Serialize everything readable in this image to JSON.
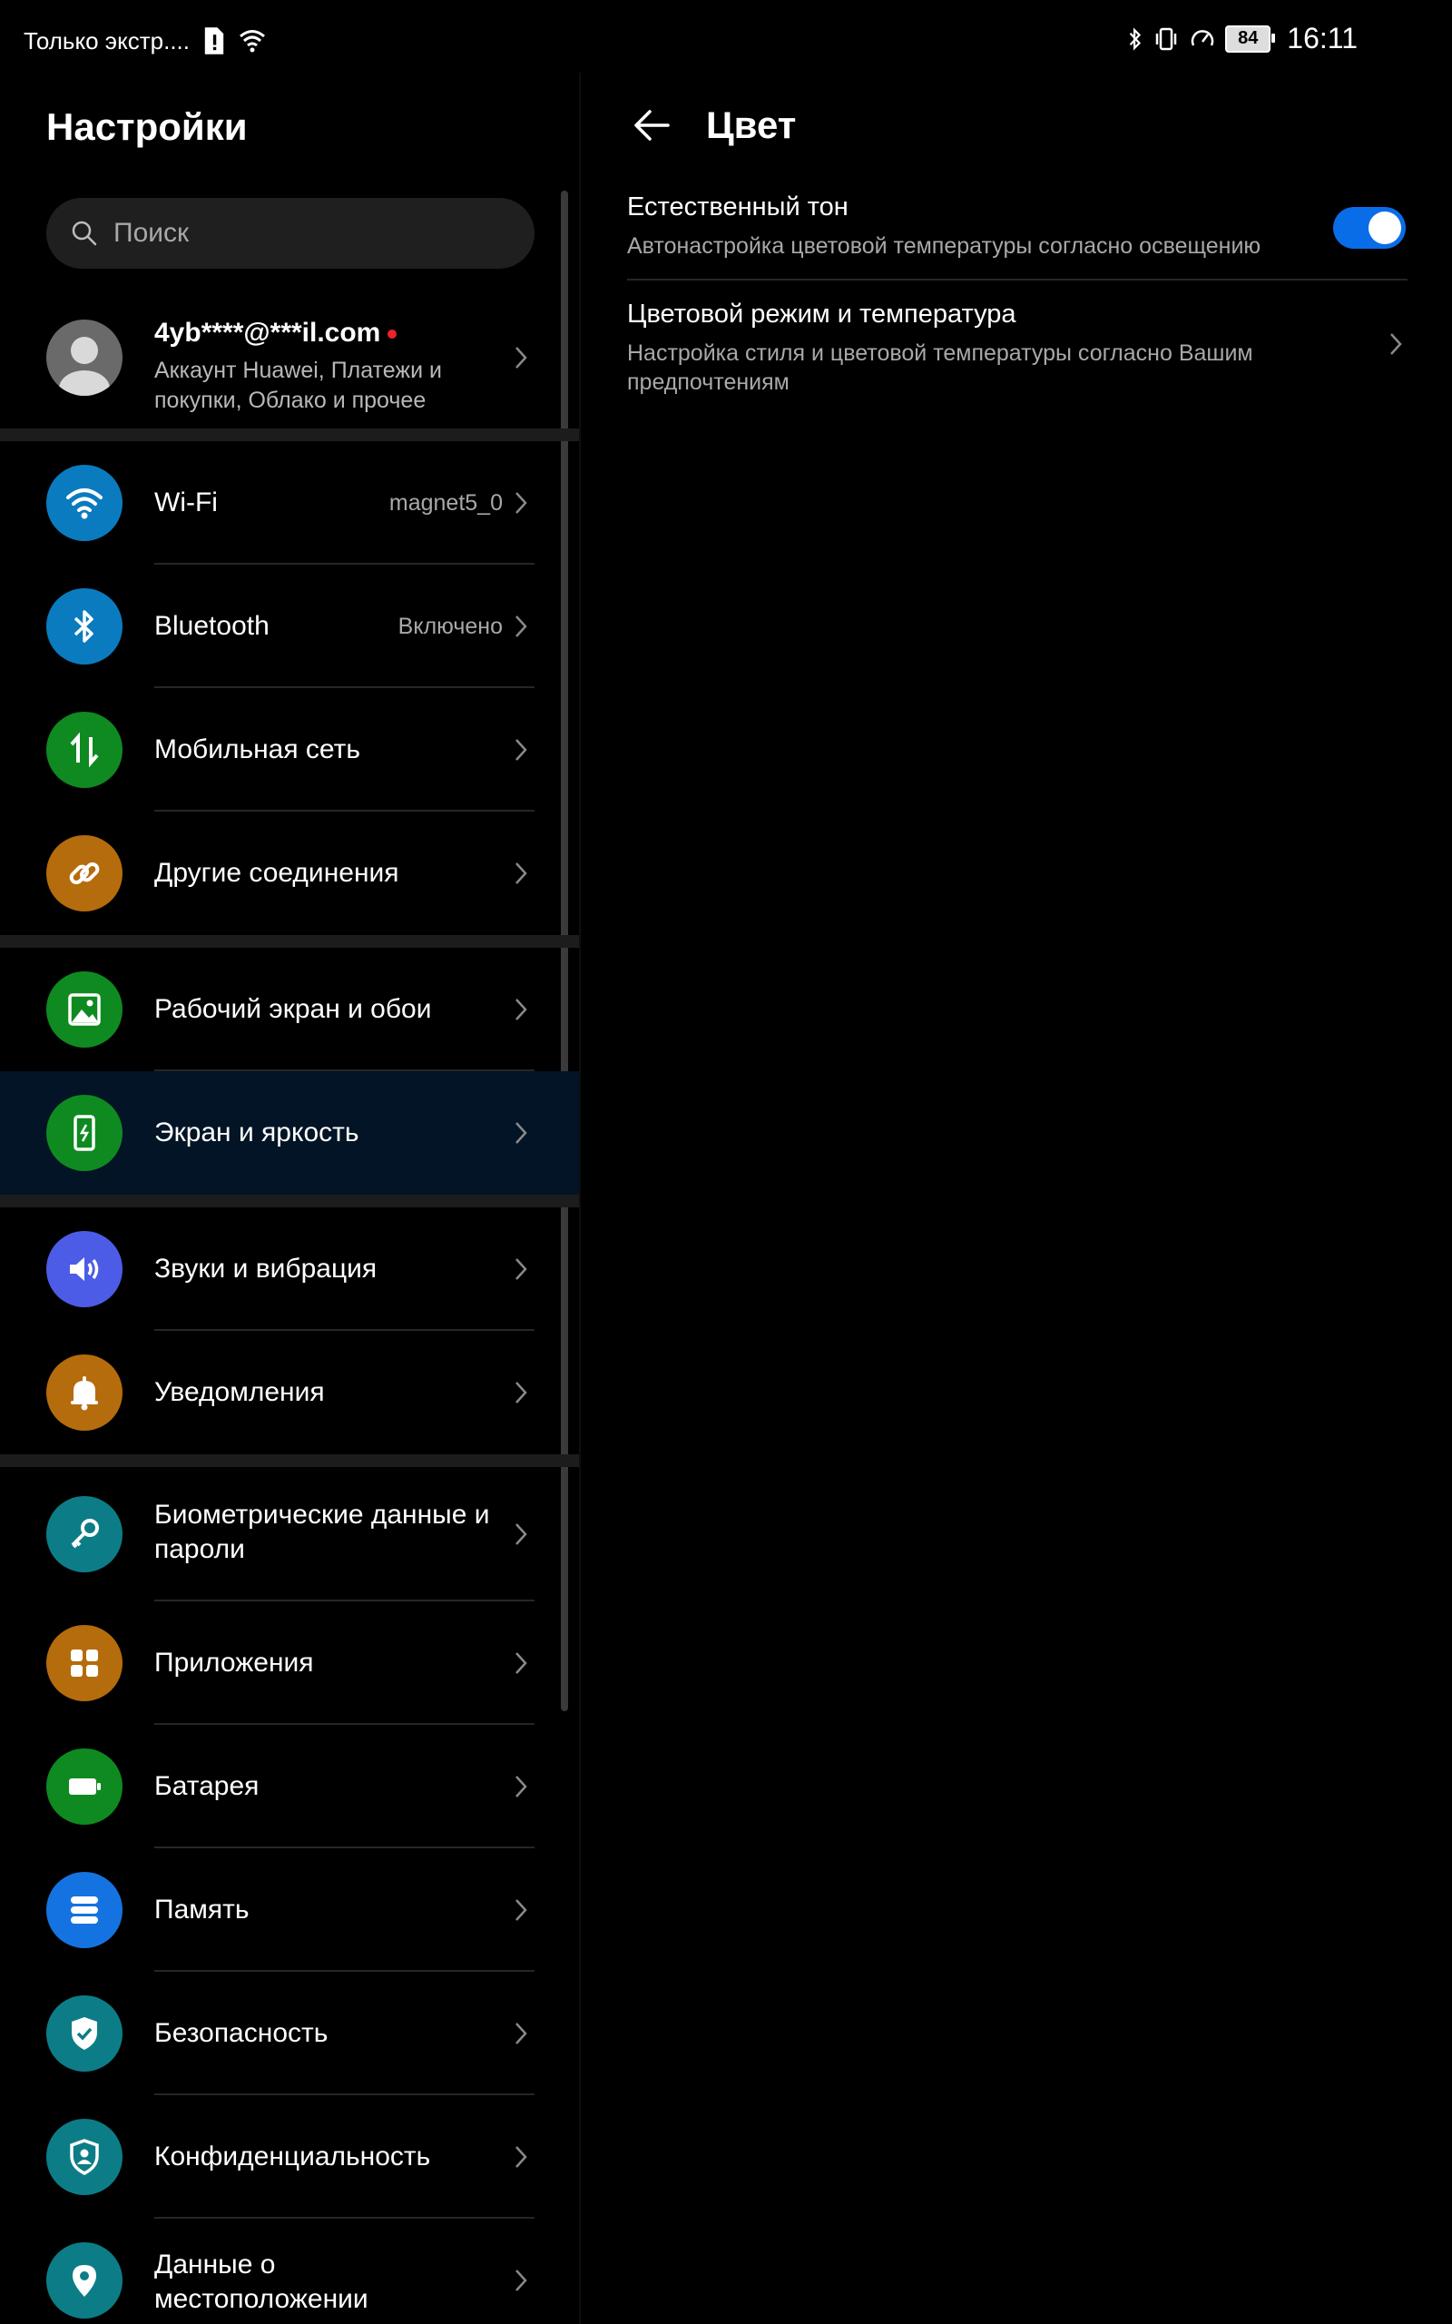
{
  "status_bar": {
    "notification_text": "Только экстр....",
    "battery": "84",
    "time": "16:11"
  },
  "settings": {
    "title": "Настройки",
    "search_placeholder": "Поиск",
    "account": {
      "email": "4yb****@***il.com",
      "description": "Аккаунт Huawei, Платежи и покупки, Облако и прочее"
    },
    "items": [
      {
        "label": "Wi-Fi",
        "value": "magnet5_0",
        "icon": "wifi-icon",
        "color": "#0b7bc0"
      },
      {
        "label": "Bluetooth",
        "value": "Включено",
        "icon": "bluetooth-icon",
        "color": "#0b7bc0"
      },
      {
        "label": "Мобильная сеть",
        "icon": "mobile-data-icon",
        "color": "#0f8a21"
      },
      {
        "label": "Другие соединения",
        "icon": "link-icon",
        "color": "#b56c0c"
      },
      {
        "label": "Рабочий экран и обои",
        "icon": "wallpaper-icon",
        "color": "#0f8a21"
      },
      {
        "label": "Экран и яркость",
        "icon": "display-icon",
        "color": "#0f8a21"
      },
      {
        "label": "Звуки и вибрация",
        "icon": "sound-icon",
        "color": "#4d5ce6"
      },
      {
        "label": "Уведомления",
        "icon": "bell-icon",
        "color": "#b56c0c"
      },
      {
        "label": "Биометрические данные и пароли",
        "icon": "key-icon",
        "color": "#0c7d86"
      },
      {
        "label": "Приложения",
        "icon": "apps-icon",
        "color": "#b56c0c"
      },
      {
        "label": "Батарея",
        "icon": "battery-icon",
        "color": "#0f8a21"
      },
      {
        "label": "Память",
        "icon": "storage-icon",
        "color": "#1473e0"
      },
      {
        "label": "Безопасность",
        "icon": "shield-icon",
        "color": "#0c7d86"
      },
      {
        "label": "Конфиденциальность",
        "icon": "privacy-icon",
        "color": "#0c7d86"
      },
      {
        "label": "Данные о местоположении",
        "icon": "location-icon",
        "color": "#0c7d86"
      }
    ]
  },
  "color_page": {
    "title": "Цвет",
    "natural_tone": {
      "title": "Естественный тон",
      "subtitle": "Автонастройка цветовой температуры согласно освещению",
      "enabled": true
    },
    "color_mode": {
      "title": "Цветовой режим и температура",
      "subtitle": "Настройка стиля и цветовой температуры согласно Вашим предпочтениям"
    }
  }
}
